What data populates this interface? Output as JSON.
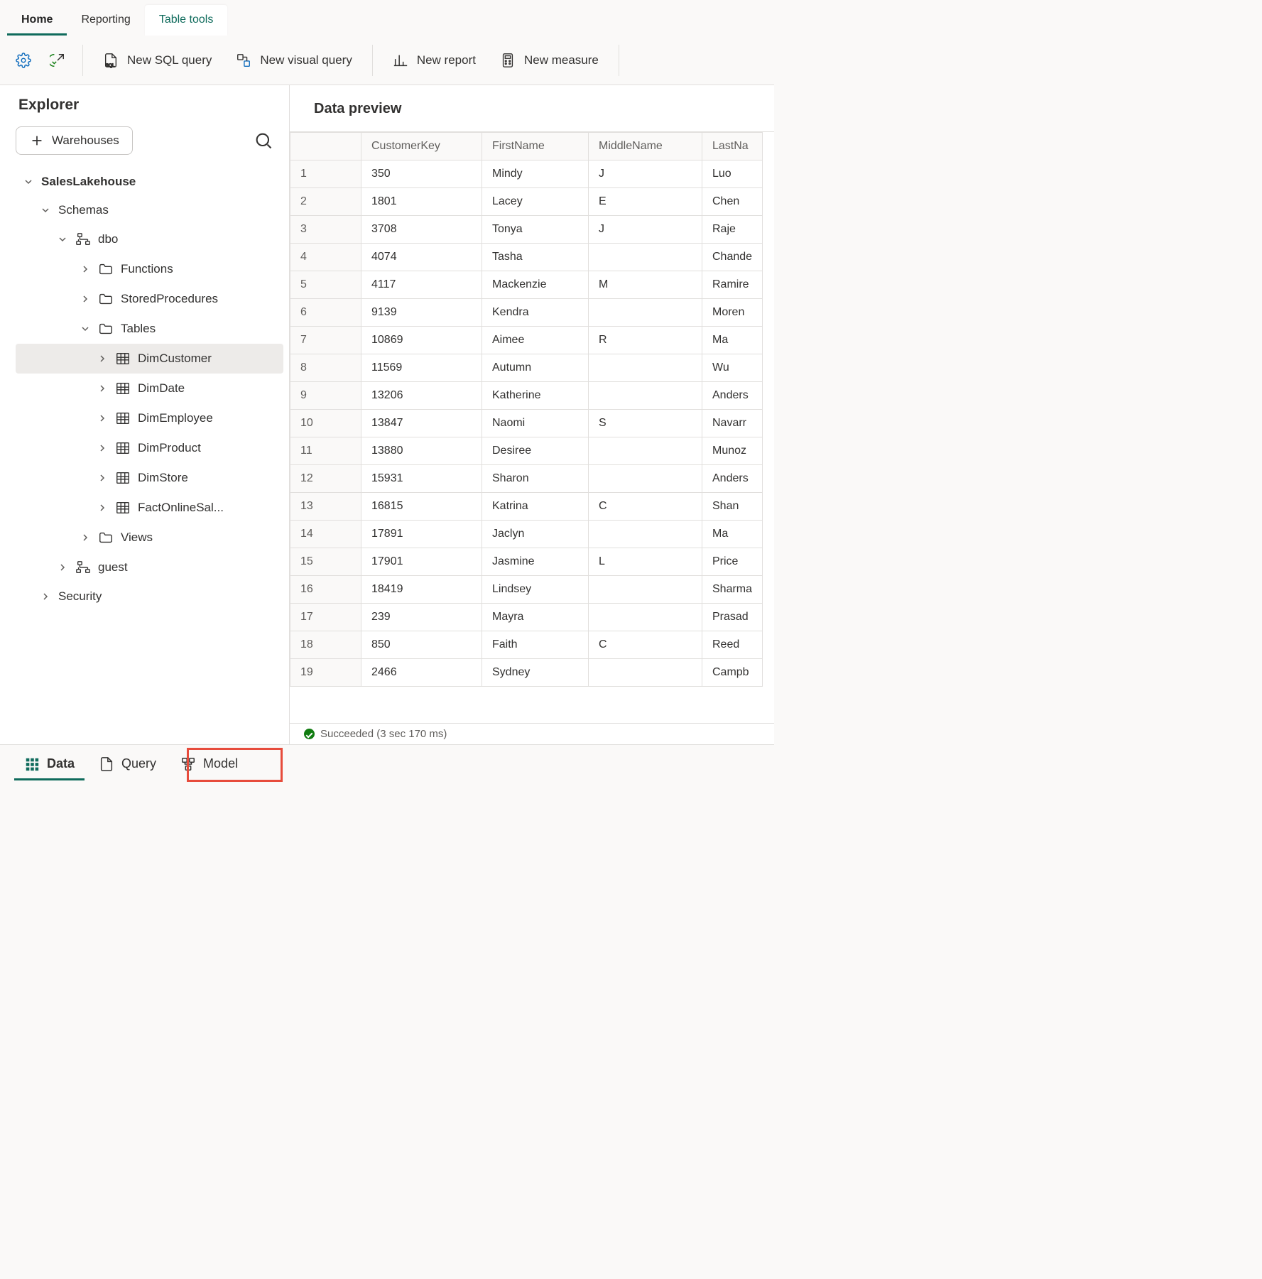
{
  "ribbon": {
    "tabs": [
      "Home",
      "Reporting",
      "Table tools"
    ]
  },
  "toolbar": {
    "new_sql_query": "New SQL query",
    "new_visual_query": "New visual query",
    "new_report": "New report",
    "new_measure": "New measure"
  },
  "explorer": {
    "title": "Explorer",
    "add_warehouses": "Warehouses",
    "tree": {
      "root": "SalesLakehouse",
      "schemas_label": "Schemas",
      "dbo_label": "dbo",
      "guest_label": "guest",
      "security_label": "Security",
      "folders": {
        "functions": "Functions",
        "stored_procs": "StoredProcedures",
        "tables": "Tables",
        "views": "Views"
      },
      "tables": [
        "DimCustomer",
        "DimDate",
        "DimEmployee",
        "DimProduct",
        "DimStore",
        "FactOnlineSal..."
      ]
    }
  },
  "preview": {
    "title": "Data preview",
    "columns": [
      "CustomerKey",
      "FirstName",
      "MiddleName",
      "LastNa"
    ],
    "rows": [
      {
        "n": "1",
        "CustomerKey": "350",
        "FirstName": "Mindy",
        "MiddleName": "J",
        "LastNa": "Luo"
      },
      {
        "n": "2",
        "CustomerKey": "1801",
        "FirstName": "Lacey",
        "MiddleName": "E",
        "LastNa": "Chen"
      },
      {
        "n": "3",
        "CustomerKey": "3708",
        "FirstName": "Tonya",
        "MiddleName": "J",
        "LastNa": "Raje"
      },
      {
        "n": "4",
        "CustomerKey": "4074",
        "FirstName": "Tasha",
        "MiddleName": "",
        "LastNa": "Chande"
      },
      {
        "n": "5",
        "CustomerKey": "4117",
        "FirstName": "Mackenzie",
        "MiddleName": "M",
        "LastNa": "Ramire"
      },
      {
        "n": "6",
        "CustomerKey": "9139",
        "FirstName": "Kendra",
        "MiddleName": "",
        "LastNa": "Moren"
      },
      {
        "n": "7",
        "CustomerKey": "10869",
        "FirstName": "Aimee",
        "MiddleName": "R",
        "LastNa": "Ma"
      },
      {
        "n": "8",
        "CustomerKey": "11569",
        "FirstName": "Autumn",
        "MiddleName": "",
        "LastNa": "Wu"
      },
      {
        "n": "9",
        "CustomerKey": "13206",
        "FirstName": "Katherine",
        "MiddleName": "",
        "LastNa": "Anders"
      },
      {
        "n": "10",
        "CustomerKey": "13847",
        "FirstName": "Naomi",
        "MiddleName": "S",
        "LastNa": "Navarr"
      },
      {
        "n": "11",
        "CustomerKey": "13880",
        "FirstName": "Desiree",
        "MiddleName": "",
        "LastNa": "Munoz"
      },
      {
        "n": "12",
        "CustomerKey": "15931",
        "FirstName": "Sharon",
        "MiddleName": "",
        "LastNa": "Anders"
      },
      {
        "n": "13",
        "CustomerKey": "16815",
        "FirstName": "Katrina",
        "MiddleName": "C",
        "LastNa": "Shan"
      },
      {
        "n": "14",
        "CustomerKey": "17891",
        "FirstName": "Jaclyn",
        "MiddleName": "",
        "LastNa": "Ma"
      },
      {
        "n": "15",
        "CustomerKey": "17901",
        "FirstName": "Jasmine",
        "MiddleName": "L",
        "LastNa": "Price"
      },
      {
        "n": "16",
        "CustomerKey": "18419",
        "FirstName": "Lindsey",
        "MiddleName": "",
        "LastNa": "Sharma"
      },
      {
        "n": "17",
        "CustomerKey": "239",
        "FirstName": "Mayra",
        "MiddleName": "",
        "LastNa": "Prasad"
      },
      {
        "n": "18",
        "CustomerKey": "850",
        "FirstName": "Faith",
        "MiddleName": "C",
        "LastNa": "Reed"
      },
      {
        "n": "19",
        "CustomerKey": "2466",
        "FirstName": "Sydney",
        "MiddleName": "",
        "LastNa": "Campb"
      }
    ],
    "status": "Succeeded (3 sec 170 ms)"
  },
  "view_tabs": {
    "data": "Data",
    "query": "Query",
    "model": "Model"
  }
}
